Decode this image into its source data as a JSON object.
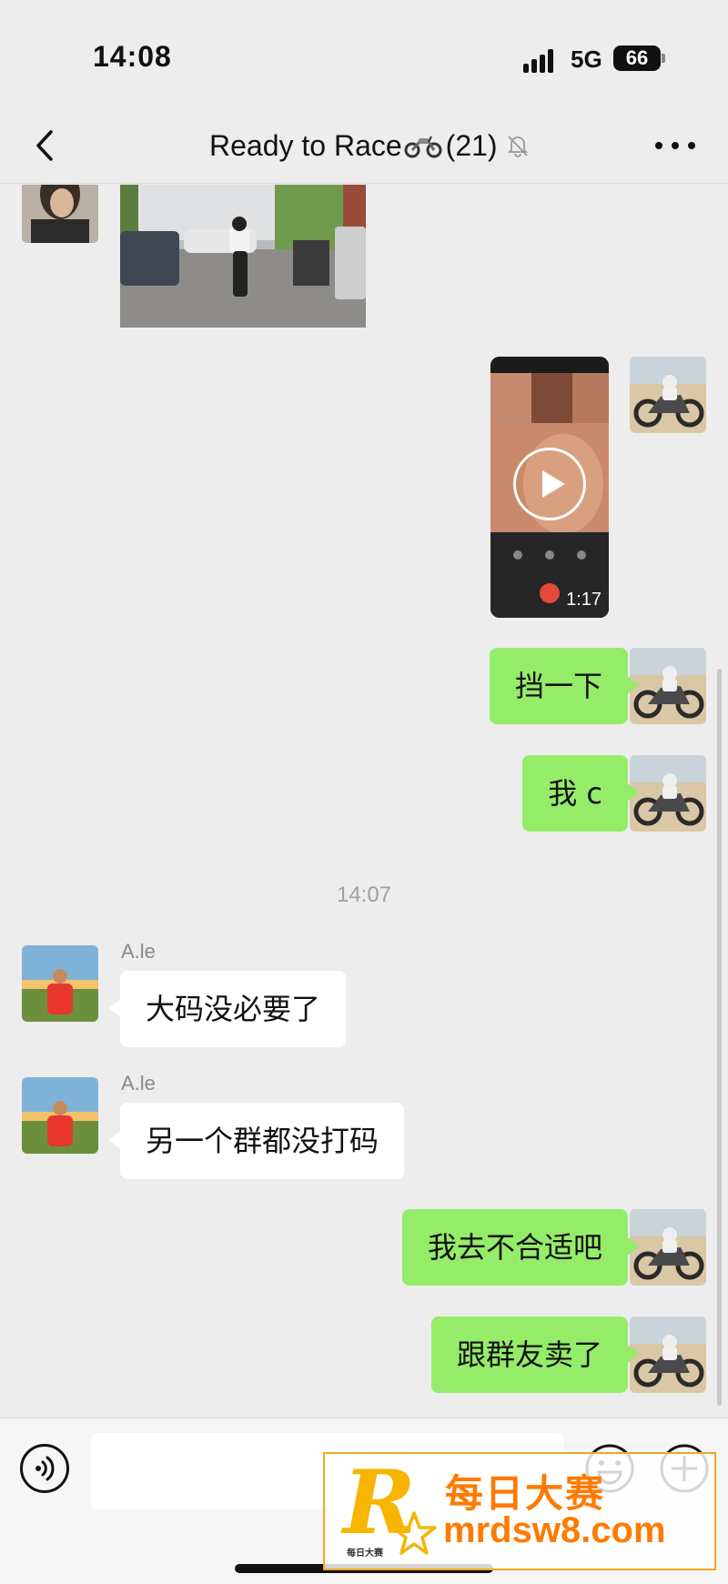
{
  "status_bar": {
    "time": "14:08",
    "network": "5G",
    "battery": "66"
  },
  "header": {
    "title": "Ready to Race",
    "member_count": "(21)"
  },
  "messages": {
    "video_duration": "1:17",
    "out_1": "挡一下",
    "out_2": "我 c",
    "timestamp": "14:07",
    "in_1_sender": "A.le",
    "in_1_text": "大码没必要了",
    "in_2_sender": "A.le",
    "in_2_text": "另一个群都没打码",
    "out_3": "我去不合适吧",
    "out_4": "跟群友卖了"
  },
  "input": {
    "placeholder": ""
  },
  "watermark": {
    "logo": "R",
    "logo_small": "每日大赛",
    "name": "每日大赛",
    "url": "mrdsw8.com"
  },
  "colors": {
    "background": "#ededed",
    "outgoing_bubble": "#95ec69",
    "incoming_bubble": "#ffffff",
    "watermark": "#ff7a00"
  },
  "icons": [
    "back-chevron-icon",
    "motorcycle-emoji-icon",
    "mute-bell-icon",
    "more-dots-icon",
    "play-icon",
    "voice-icon",
    "emoji-icon",
    "plus-icon"
  ]
}
